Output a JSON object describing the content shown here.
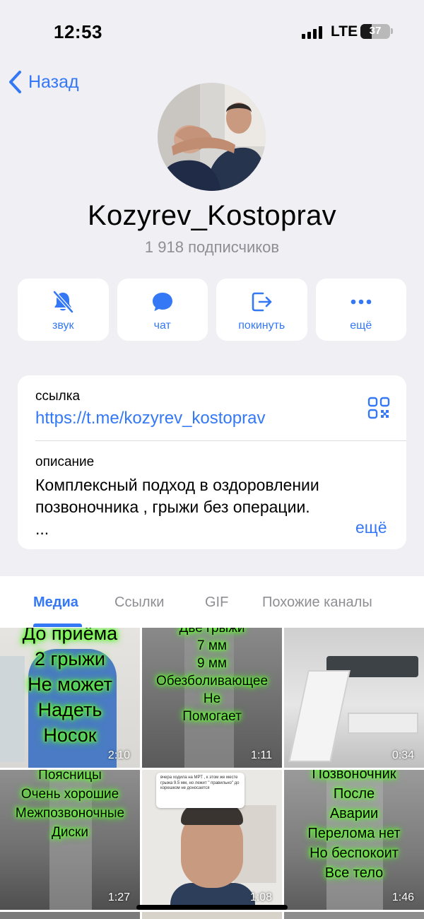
{
  "status_bar": {
    "time": "12:53",
    "network": "LTE",
    "battery": "37",
    "battery_level": 0.37
  },
  "nav": {
    "back_label": "Назад"
  },
  "channel": {
    "name": "Kozyrev_Kostoprav",
    "subscribers": "1 918 подписчиков"
  },
  "actions": [
    {
      "label": "звук",
      "icon": "bell-slash-icon"
    },
    {
      "label": "чат",
      "icon": "chat-bubble-icon"
    },
    {
      "label": "покинуть",
      "icon": "leave-icon"
    },
    {
      "label": "ещё",
      "icon": "more-dots-icon"
    }
  ],
  "info": {
    "link_label": "ссылка",
    "link": "https://t.me/kozyrev_kostoprav",
    "description_label": "описание",
    "description_line1": "Комплексный подход в оздоровлении",
    "description_line2": "позвоночника , грыжи без операции.",
    "description_line3": "...",
    "more": "ещё"
  },
  "tabs": [
    "Медиа",
    "Ссылки",
    "GIF",
    "Похожие каналы"
  ],
  "active_tab": "Медиа",
  "media": [
    {
      "lines": [
        "До приёма",
        "2 грыжи",
        "Не может",
        "Надеть",
        "Носок"
      ],
      "duration": "2:10"
    },
    {
      "lines": [
        "Две грыжи",
        "7 мм",
        "9 мм",
        "Обезболивающее",
        "Не",
        "Помогает"
      ],
      "duration": "1:11"
    },
    {
      "lines": [],
      "duration": "0:34"
    },
    {
      "lines": [
        "Поясницы",
        "Очень хорошие",
        "Межпозвоночные",
        "Диски"
      ],
      "duration": "1:27"
    },
    {
      "lines": [],
      "comment": "вчера ходила на МРТ , к этом же месте грыжа 9.5 мм, но лежит \" правильно\" до корешком не доносается",
      "duration": "1:08"
    },
    {
      "lines": [
        "Позвоночник",
        "После",
        "Аварии",
        "Перелома нет",
        "Но беспокоит",
        "Все тело"
      ],
      "duration": "1:46"
    }
  ]
}
